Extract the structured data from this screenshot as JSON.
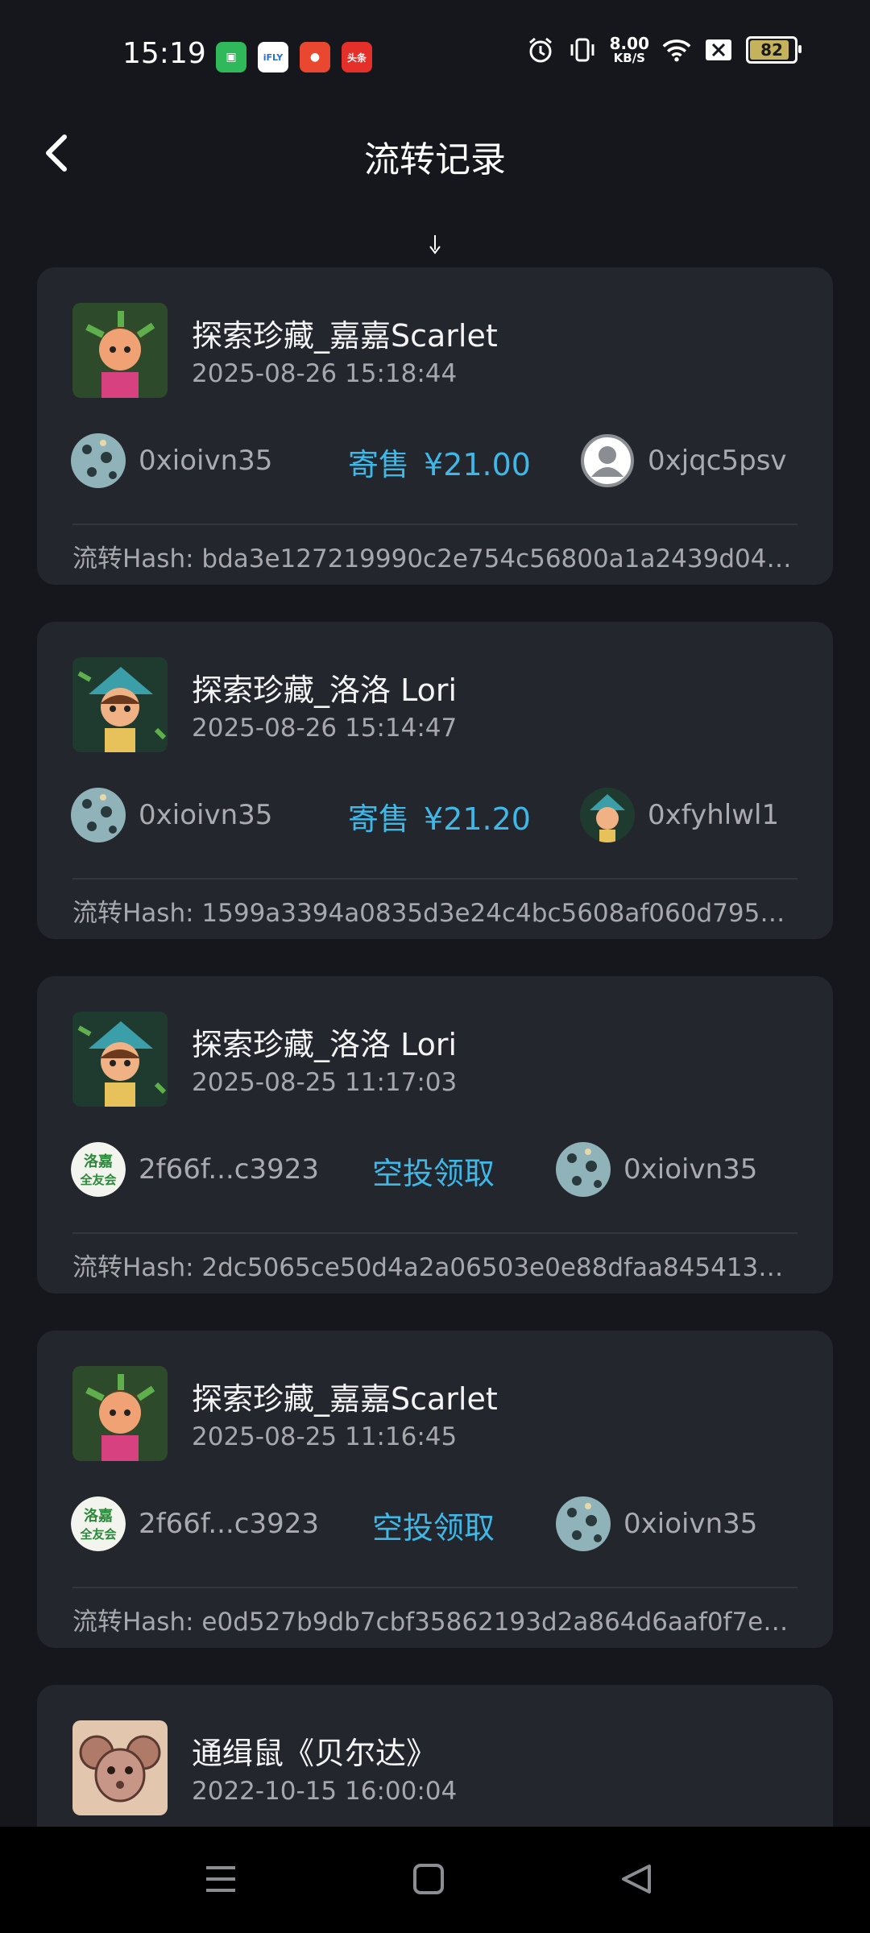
{
  "status_bar": {
    "time": "15:19",
    "speed_value": "8.00",
    "speed_unit": "KB/S",
    "battery": "82",
    "icons": [
      "alarm-icon",
      "vibrate-icon",
      "wifi-icon",
      "sim-x-icon"
    ]
  },
  "header": {
    "title": "流转记录",
    "back_icon": "chevron-left-icon"
  },
  "records": [
    {
      "name": "探索珍藏_嘉嘉Scarlet",
      "date": "2025-08-26 15:18:44",
      "from": "0xioivn35",
      "action": "寄售",
      "price": "¥21.00",
      "to": "0xjqc5psv",
      "hash_label": "流转Hash: ",
      "hash": "bda3e127219990c2e754c56800a1a2439d04ba5..."
    },
    {
      "name": "探索珍藏_洛洛 Lori",
      "date": "2025-08-26 15:14:47",
      "from": "0xioivn35",
      "action": "寄售",
      "price": "¥21.20",
      "to": "0xfyhlwl1",
      "hash_label": "流转Hash: ",
      "hash": "1599a3394a0835d3e24c4bc5608af060d795a9b..."
    },
    {
      "name": "探索珍藏_洛洛 Lori",
      "date": "2025-08-25 11:17:03",
      "from": "2f66f...c3923",
      "action": "空投领取",
      "price": "",
      "to": "0xioivn35",
      "hash_label": "流转Hash: ",
      "hash": "2dc5065ce50d4a2a06503e0e88dfaa845413509..."
    },
    {
      "name": "探索珍藏_嘉嘉Scarlet",
      "date": "2025-08-25 11:16:45",
      "from": "2f66f...c3923",
      "action": "空投领取",
      "price": "",
      "to": "0xioivn35",
      "hash_label": "流转Hash: ",
      "hash": "e0d527b9db7cbf35862193d2a864d6aaf0f7e6f0..."
    },
    {
      "name": "通缉鼠《贝尔达》",
      "date": "2022-10-15 16:00:04"
    }
  ],
  "airdrop_avatar_text": [
    "洛嘉",
    "全友会"
  ],
  "colors": {
    "background": "#15171c",
    "card": "#23262c",
    "accent": "#3fb8e8"
  }
}
